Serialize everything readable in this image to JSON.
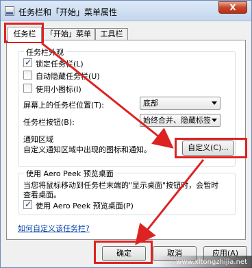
{
  "window": {
    "title": "任务栏和「开始」菜单属性",
    "close_label": "X"
  },
  "tabs": [
    {
      "label": "任务栏",
      "active": true
    },
    {
      "label": "「开始」菜单",
      "active": false
    },
    {
      "label": "工具栏",
      "active": false
    }
  ],
  "appearance": {
    "title": "任务栏外观",
    "lock": {
      "label": "锁定任务栏(L)",
      "checked": true
    },
    "autohide": {
      "label": "自动隐藏任务栏(U)",
      "checked": false
    },
    "small_icons": {
      "label": "使用小图标(I)",
      "checked": false
    },
    "position_label": "屏幕上的任务栏位置(T):",
    "position_value": "底部",
    "buttons_label": "任务栏按钮(B):",
    "buttons_value": "始终合并、隐藏标签"
  },
  "notification": {
    "title": "通知区域",
    "description": "自定义通知区域中出现的图标和通知。",
    "customize_label": "自定义(C)..."
  },
  "aero_peek": {
    "title": "使用 Aero Peek 预览桌面",
    "description_1": "当您将鼠标移动到任务栏末端的\"显示桌面\"按钮时，会暂时",
    "description_2": "查看桌面。",
    "checkbox": {
      "label": "使用 Aero Peek 预览桌面(P)",
      "checked": true
    }
  },
  "help_link": "如何自定义该任务栏?",
  "footer": {
    "ok_label": "确定",
    "cancel_label": "取消",
    "apply_label": "应用(A)"
  },
  "annotation_color": "#dd2222",
  "watermark": "www.xitongzhijia.net"
}
